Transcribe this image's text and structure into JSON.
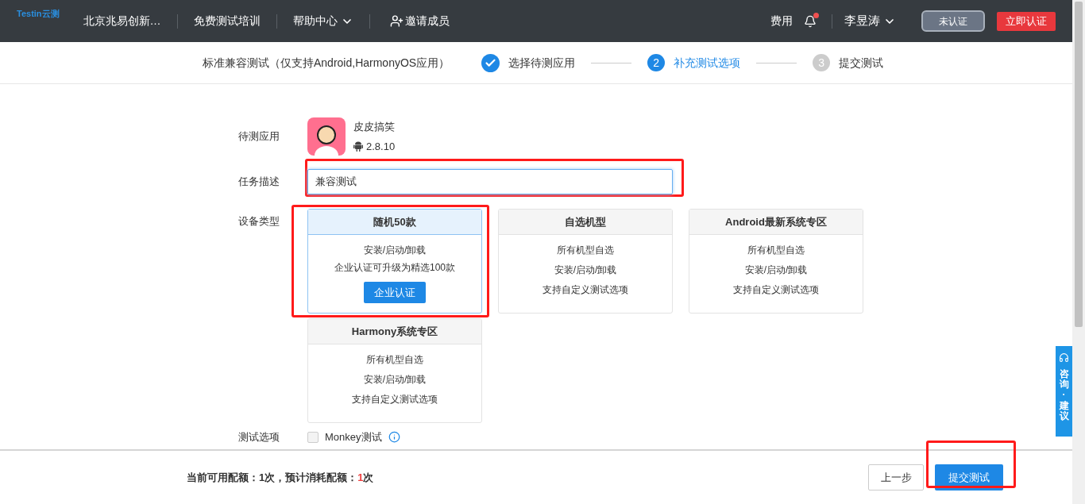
{
  "header": {
    "logo": "Testin云测",
    "nav": [
      {
        "kind": "text",
        "label": "北京兆易创新…"
      },
      {
        "kind": "text",
        "label": "免费测试培训"
      },
      {
        "kind": "dropdown",
        "label": "帮助中心"
      },
      {
        "kind": "invite",
        "label": "邀请成员"
      }
    ],
    "fees": "费用",
    "unread": true,
    "user": "李昱涛",
    "cert_badge": "未认证",
    "cert_button": "立即认证"
  },
  "steps": {
    "title": "标准兼容测试（仅支持Android,HarmonyOS应用）",
    "items": [
      {
        "completed": true,
        "selected": false,
        "label": "选择待测应用"
      },
      {
        "completed": false,
        "selected": true,
        "number": "2",
        "label": "补充测试选项"
      },
      {
        "completed": false,
        "selected": false,
        "number": "3",
        "label": "提交测试"
      }
    ]
  },
  "form": {
    "app": {
      "label": "待测应用",
      "name": "皮皮搞笑",
      "version": "2.8.10"
    },
    "description": {
      "label": "任务描述",
      "value": "兼容测试"
    },
    "devices": {
      "label": "设备类型",
      "cards": [
        {
          "title": "随机50款",
          "selected": true,
          "lines": [
            "安装/启动/卸载",
            "企业认证可升级为精选100款"
          ],
          "button": "企业认证"
        },
        {
          "title": "自选机型",
          "selected": false,
          "lines": [
            "所有机型自选",
            "安装/启动/卸载",
            "支持自定义测试选项"
          ]
        },
        {
          "title": "Android最新系统专区",
          "selected": false,
          "lines": [
            "所有机型自选",
            "安装/启动/卸载",
            "支持自定义测试选项"
          ]
        },
        {
          "title": "Harmony系统专区",
          "selected": false,
          "lines": [
            "所有机型自选",
            "安装/启动/卸载",
            "支持自定义测试选项"
          ]
        }
      ]
    },
    "options": {
      "label": "测试选项",
      "items": [
        {
          "label": "Monkey测试",
          "checked": false
        }
      ]
    }
  },
  "footer": {
    "quota": [
      {
        "kind": "normal",
        "text": "当前可用配额："
      },
      {
        "kind": "normal",
        "text": "1次，预计消耗配额："
      },
      {
        "kind": "warning",
        "text": "1"
      },
      {
        "kind": "normal",
        "text": "次"
      }
    ],
    "prev": "上一步",
    "submit": "提交测试"
  },
  "consult_tab": "咨询·建议"
}
